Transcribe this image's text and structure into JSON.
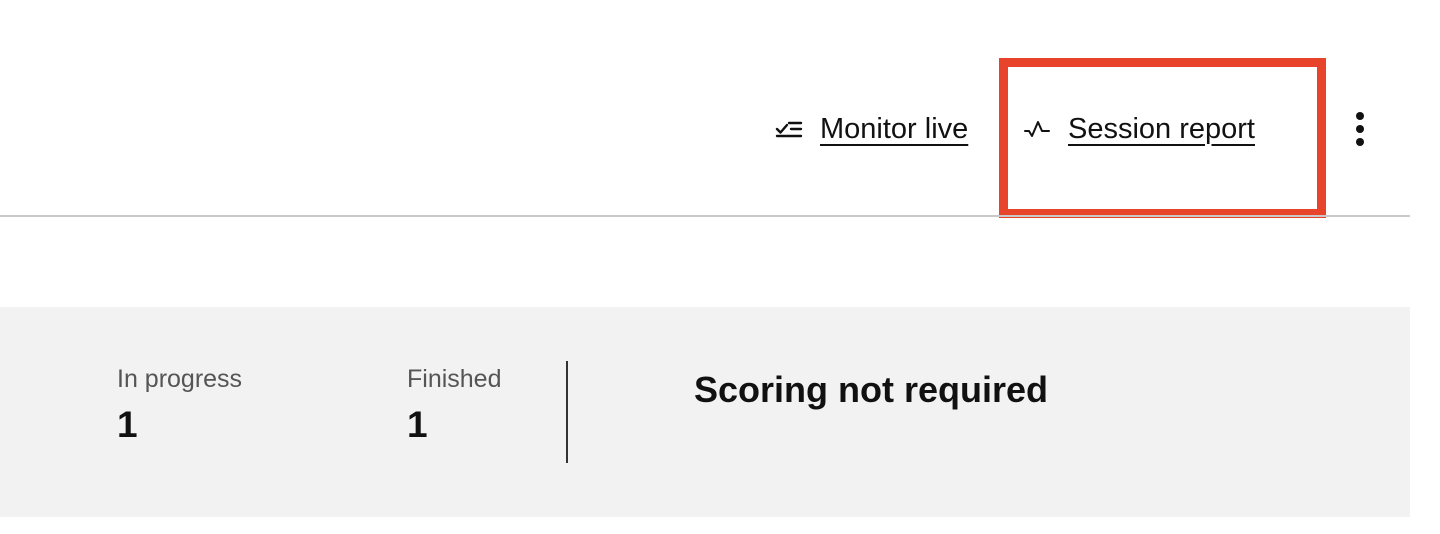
{
  "toolbar": {
    "monitor_live": {
      "label": "Monitor live",
      "icon": "checklist-icon"
    },
    "session_report": {
      "label": "Session report",
      "icon": "pulse-icon"
    },
    "more_menu": {
      "icon": "more-vertical-icon"
    }
  },
  "highlight": {
    "color": "#e8432b",
    "target": "session-report-link"
  },
  "summary": {
    "in_progress": {
      "label": "In progress",
      "value": "1"
    },
    "finished": {
      "label": "Finished",
      "value": "1"
    },
    "scoring_status": "Scoring not required",
    "background": "#f2f2f2"
  }
}
